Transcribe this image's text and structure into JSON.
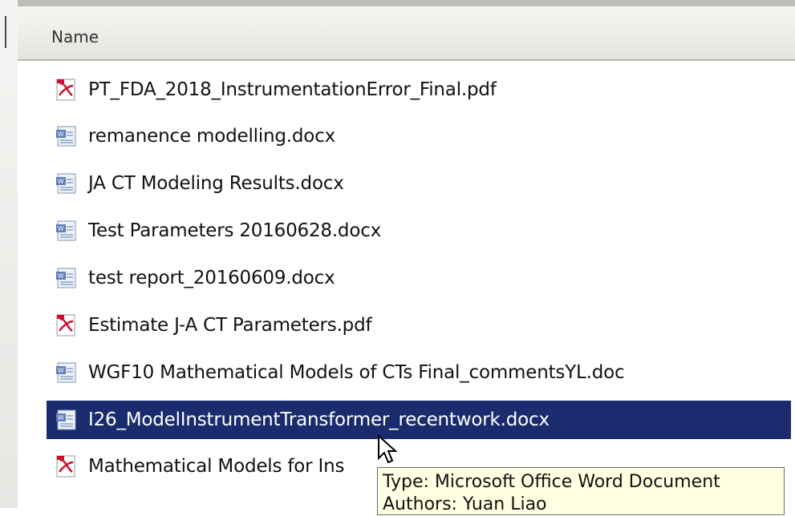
{
  "header": {
    "column_name": "Name"
  },
  "files": [
    {
      "name": "PT_FDA_2018_InstrumentationError_Final.pdf",
      "icon": "pdf-icon",
      "selected": false
    },
    {
      "name": "remanence modelling.docx",
      "icon": "word-doc-icon",
      "selected": false
    },
    {
      "name": "JA CT Modeling Results.docx",
      "icon": "word-doc-icon",
      "selected": false
    },
    {
      "name": "Test Parameters 20160628.docx",
      "icon": "word-doc-icon",
      "selected": false
    },
    {
      "name": "test report_20160609.docx",
      "icon": "word-doc-icon",
      "selected": false
    },
    {
      "name": "Estimate J-A CT Parameters.pdf",
      "icon": "pdf-icon",
      "selected": false
    },
    {
      "name": "WGF10 Mathematical Models of CTs Final_commentsYL.doc",
      "icon": "word-doc-icon",
      "selected": false
    },
    {
      "name": "I26_ModelInstrumentTransformer_recentwork.docx",
      "icon": "word-doc-icon",
      "selected": true
    },
    {
      "name": "Mathematical Models for Ins",
      "icon": "pdf-icon",
      "selected": false
    }
  ],
  "tooltip": {
    "line1": "Type: Microsoft Office Word Document",
    "line2": "Authors: Yuan Liao"
  },
  "colors": {
    "selection": "#1a2c6e",
    "tooltip_bg": "#ffffe1"
  }
}
